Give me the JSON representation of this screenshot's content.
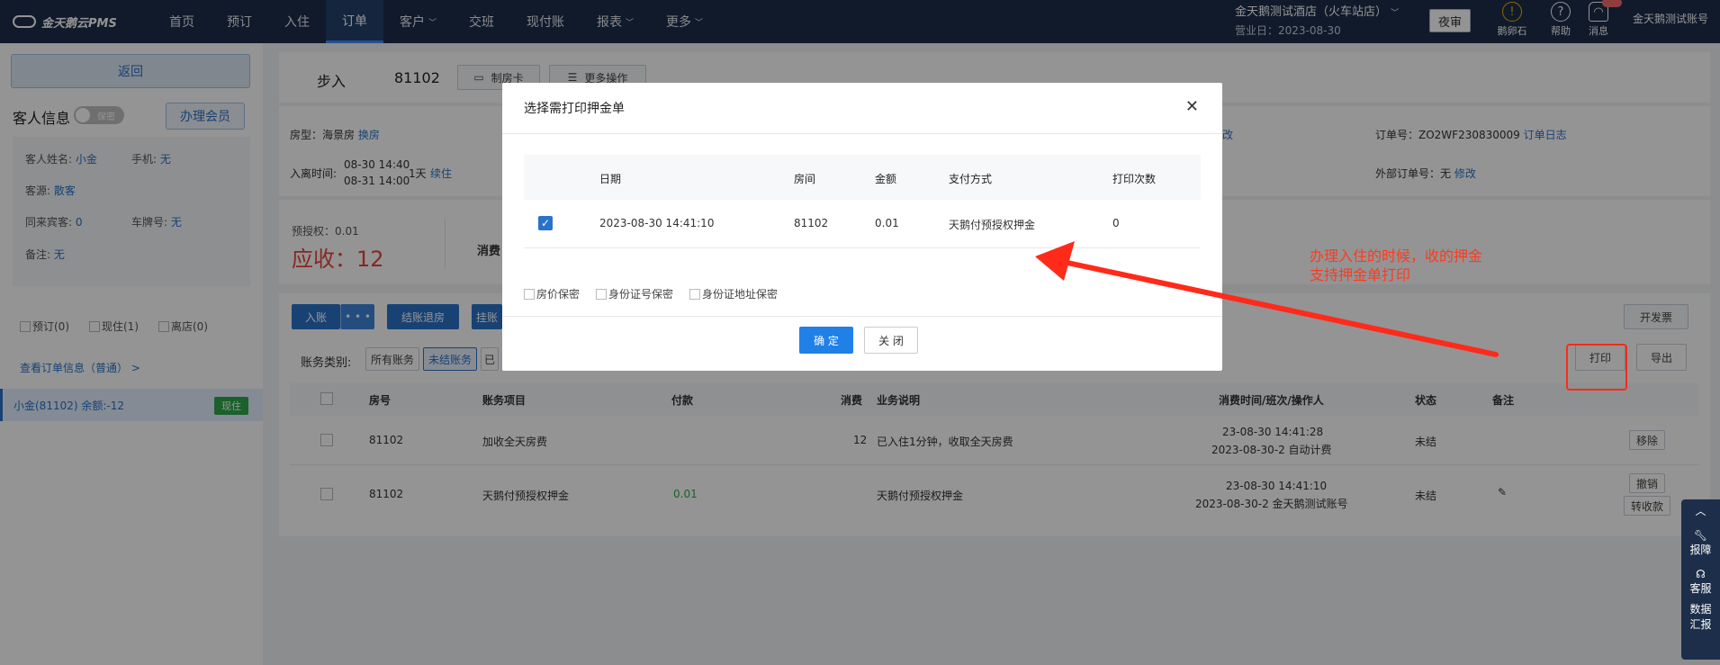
{
  "nav": {
    "logo": "金天鹅云PMS",
    "items": [
      "首页",
      "预订",
      "入住",
      "订单",
      "客户",
      "交班",
      "现付账",
      "报表",
      "更多"
    ],
    "hotel_name": "金天鹅测试酒店（火车站店）",
    "business_date": "营业日：2023-08-30",
    "night_audit": "夜审",
    "icon_labels": [
      "鹅卵石",
      "帮助",
      "消息"
    ],
    "account": "金天鹅测试账号"
  },
  "sidebar": {
    "back": "返回",
    "guest_info": "客人信息",
    "toggle": "保密",
    "member_btn": "办理会员",
    "name_label": "客人姓名:",
    "name_value": "小金",
    "phone_label": "手机:",
    "phone_value": "无",
    "source_label": "客源:",
    "source_value": "散客",
    "companion_label": "同来宾客:",
    "companion_value": "0",
    "plate_label": "车牌号:",
    "plate_value": "无",
    "remark_label": "备注:",
    "remark_value": "无",
    "status": [
      "预订(0)",
      "现住(1)",
      "离店(0)"
    ],
    "order_link": "查看订单信息（普通） >",
    "guest_row": "小金(81102)  余额:-12",
    "guest_tag": "现住"
  },
  "main": {
    "title_label": "步入",
    "room": "81102",
    "make_card": "制房卡",
    "more_ops": "更多操作",
    "room_type_label": "房型：海景房",
    "change_room": "换房",
    "checkin_label": "入离时间:",
    "checkin_time": "08-30 14:40",
    "checkout_time": "08-31 14:00",
    "days": "1天",
    "extend": "续住",
    "modify1": "改",
    "order_no": "订单号：ZO2WF230830009",
    "order_log": "订单日志",
    "ext_order": "外部订单号：无",
    "modify2": "修改",
    "preauth": "预授权：0.01",
    "receivable": "应收：12",
    "consume": "消费",
    "post_btn": "入账",
    "settle_btn": "结账退房",
    "hang_btn": "挂账",
    "invoice_btn": "开发票",
    "print_btn": "打印",
    "export_btn": "导出",
    "category_label": "账务类别:",
    "cat_all": "所有账务",
    "cat_unsettled": "未结账务",
    "cat_settled": "已"
  },
  "ledger": {
    "headers": [
      "房号",
      "账务项目",
      "付款",
      "消费",
      "业务说明",
      "消费时间/班次/操作人",
      "状态",
      "备注"
    ],
    "rows": [
      {
        "room": "81102",
        "item": "加收全天房费",
        "pay": "",
        "consume": "12",
        "desc": "已入住1分钟，收取全天房费",
        "time1": "23-08-30 14:41:28",
        "time2": "2023-08-30-2 自动计费",
        "status": "未结",
        "act1": "移除",
        "act2": ""
      },
      {
        "room": "81102",
        "item": "天鹅付预授权押金",
        "pay": "0.01",
        "consume": "",
        "desc": "天鹅付预授权押金",
        "time1": "23-08-30 14:41:10",
        "time2": "2023-08-30-2 金天鹅测试账号",
        "status": "未结",
        "act1": "撤销",
        "act2": "转收款"
      }
    ]
  },
  "toolbar": [
    "报障",
    "客服",
    "数据汇报"
  ],
  "modal": {
    "title": "选择需打印押金单",
    "headers": [
      "日期",
      "房间",
      "金额",
      "支付方式",
      "打印次数"
    ],
    "row": {
      "date": "2023-08-30 14:41:10",
      "room": "81102",
      "amount": "0.01",
      "method": "天鹅付预授权押金",
      "count": "0"
    },
    "options": [
      "房价保密",
      "身份证号保密",
      "身份证地址保密"
    ],
    "ok": "确 定",
    "cancel": "关 闭"
  },
  "annotation": {
    "line1": "办理入住的时候，收的押金",
    "line2": "支持押金单打印",
    "color": "#ff2a1a"
  }
}
